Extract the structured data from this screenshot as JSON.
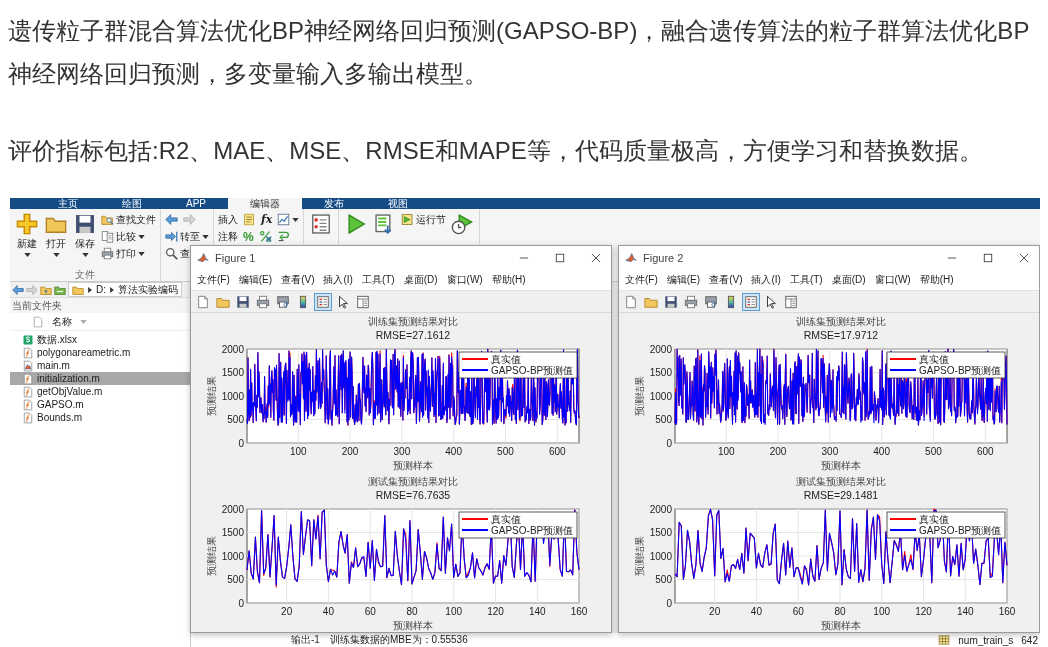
{
  "article": {
    "paragraphs": [
      "遗传粒子群混合算法优化BP神经网络回归预测(GAPSO-BP)，融合遗传算法的粒子群算法优化BP神经网络回归预测，多变量输入多输出模型。",
      "评价指标包括:R2、MAE、MSE、RMSE和MAPE等，代码质量极高，方便学习和替换数据。"
    ]
  },
  "matlab": {
    "tabs": [
      {
        "label": "主页",
        "selected": false
      },
      {
        "label": "绘图",
        "selected": false
      },
      {
        "label": "APP",
        "selected": false
      },
      {
        "label": "编辑器",
        "selected": true
      },
      {
        "label": "发布",
        "selected": false
      },
      {
        "label": "视图",
        "selected": false
      }
    ],
    "ribbon_groups": [
      {
        "label": "文件",
        "columns": [
          {
            "button": {
              "kind": "new",
              "label": "新建",
              "dropdown": true
            }
          },
          {
            "button": {
              "kind": "open",
              "label": "打开",
              "dropdown": true
            }
          },
          {
            "button": {
              "kind": "save",
              "label": "保存",
              "dropdown": true
            }
          },
          {
            "rows": [
              [
                {
                  "kind": "findfile",
                  "label": "查找文件",
                  "dropdown": false
                }
              ],
              [
                {
                  "kind": "compare",
                  "label": "比较",
                  "dropdown": true
                }
              ],
              [
                {
                  "kind": "print",
                  "label": "打印",
                  "dropdown": true
                }
              ]
            ]
          }
        ]
      },
      {
        "columns": [
          {
            "rows": [
              [
                {
                  "kind": "back",
                  "dropdown": false
                },
                {
                  "kind": "forward",
                  "dropdown": false
                }
              ],
              [
                {
                  "kind": "goto",
                  "label": "转至",
                  "dropdown": true
                }
              ],
              [
                {
                  "kind": "find",
                  "label": "查",
                  "dropdown": false
                }
              ]
            ]
          }
        ]
      },
      {
        "columns": [
          {
            "rows": [
              [
                {
                  "kind": "text",
                  "label": "插入",
                  "dropdown": false
                },
                {
                  "kind": "note",
                  "dropdown": false
                },
                {
                  "kind": "fx",
                  "label": "fx",
                  "dropdown": false
                },
                {
                  "kind": "figure",
                  "dropdown": true
                }
              ],
              [
                {
                  "kind": "text",
                  "label": "注释",
                  "dropdown": false
                },
                {
                  "kind": "glyph",
                  "label": "%",
                  "dropdown": false
                },
                {
                  "kind": "uncomment",
                  "dropdown": false
                },
                {
                  "kind": "wrap",
                  "dropdown": false
                }
              ]
            ]
          }
        ]
      },
      {
        "columns": [
          {
            "button": {
              "kind": "breakpoint",
              "dropdown": false
            }
          }
        ]
      },
      {
        "columns": [
          {
            "button": {
              "kind": "run",
              "dropdown": false
            }
          },
          {
            "button": {
              "kind": "runadvance",
              "dropdown": false
            }
          },
          {
            "rows": [
              [
                {
                  "kind": "runsection",
                  "label": "运行节",
                  "dropdown": false
                }
              ]
            ]
          },
          {
            "button": {
              "kind": "runtime",
              "dropdown": false
            }
          }
        ]
      }
    ],
    "path": [
      "D:",
      "算法实验编码"
    ],
    "panel_title": "当前文件夹",
    "column_header": "名称",
    "files": [
      {
        "name": "数据.xlsx",
        "kind": "excel",
        "selected": false
      },
      {
        "name": "polygonareametric.m",
        "kind": "function",
        "selected": false
      },
      {
        "name": "main.m",
        "kind": "script",
        "selected": false
      },
      {
        "name": "initialization.m",
        "kind": "function",
        "selected": true
      },
      {
        "name": "getObjValue.m",
        "kind": "function",
        "selected": false
      },
      {
        "name": "GAPSO.m",
        "kind": "function",
        "selected": false
      },
      {
        "name": "Bounds.m",
        "kind": "function",
        "selected": false
      }
    ],
    "command_output": {
      "prompt": "输出-1",
      "text": "训练集数据的MBE为：0.55536"
    },
    "workspace_row": {
      "name": "num_train_s",
      "value": "642"
    }
  },
  "figures": [
    {
      "title": "Figure 1",
      "menu": [
        "文件(F)",
        "编辑(E)",
        "查看(V)",
        "插入(I)",
        "工具(T)",
        "桌面(D)",
        "窗口(W)",
        "帮助(H)"
      ],
      "toolbar": [
        {
          "kind": "newfig",
          "pressed": false
        },
        {
          "kind": "open",
          "pressed": false
        },
        {
          "kind": "save",
          "pressed": false
        },
        {
          "kind": "print",
          "pressed": false
        },
        {
          "kind": "preview",
          "pressed": false
        },
        {
          "kind": "colorbar",
          "pressed": false
        },
        {
          "kind": "legend",
          "pressed": true
        },
        {
          "kind": "pointer",
          "pressed": false
        },
        {
          "kind": "inspector",
          "pressed": false
        }
      ],
      "plots": [
        {
          "title": "训练集预测结果对比",
          "subtitle": "RMSE=27.1612",
          "ylabel": "预测结果",
          "xlabel": "预测样本",
          "yticks": [
            "2000",
            "1500",
            "1000",
            "500",
            "0"
          ],
          "xticks": [
            "100",
            "200",
            "300",
            "400",
            "500",
            "600"
          ],
          "legend": [
            {
              "label": "真实值",
              "color": "#ff0000"
            },
            {
              "label": "GAPSO-BP预测值",
              "color": "#0000ff"
            }
          ]
        },
        {
          "title": "测试集预测结果对比",
          "subtitle": "RMSE=76.7635",
          "ylabel": "预测结果",
          "xlabel": "预测样本",
          "yticks": [
            "2000",
            "1500",
            "1000",
            "500",
            "0"
          ],
          "xticks": [
            "20",
            "40",
            "60",
            "80",
            "100",
            "120",
            "140",
            "160"
          ],
          "legend": [
            {
              "label": "真实值",
              "color": "#ff0000"
            },
            {
              "label": "GAPSO-BP预测值",
              "color": "#0000ff"
            }
          ]
        }
      ]
    },
    {
      "title": "Figure 2",
      "menu": [
        "文件(F)",
        "编辑(E)",
        "查看(V)",
        "插入(I)",
        "工具(T)",
        "桌面(D)",
        "窗口(W)",
        "帮助(H)"
      ],
      "toolbar": [
        {
          "kind": "newfig",
          "pressed": false
        },
        {
          "kind": "open",
          "pressed": false
        },
        {
          "kind": "save",
          "pressed": false
        },
        {
          "kind": "print",
          "pressed": false
        },
        {
          "kind": "preview",
          "pressed": false
        },
        {
          "kind": "colorbar",
          "pressed": false
        },
        {
          "kind": "legend",
          "pressed": true
        },
        {
          "kind": "pointer",
          "pressed": false
        },
        {
          "kind": "inspector",
          "pressed": false
        }
      ],
      "plots": [
        {
          "title": "训练集预测结果对比",
          "subtitle": "RMSE=17.9712",
          "ylabel": "预测结果",
          "xlabel": "预测样本",
          "yticks": [
            "2000",
            "1500",
            "1000",
            "500",
            "0"
          ],
          "xticks": [
            "100",
            "200",
            "300",
            "400",
            "500",
            "600"
          ],
          "legend": [
            {
              "label": "真实值",
              "color": "#ff0000"
            },
            {
              "label": "GAPSO-BP预测值",
              "color": "#0000ff"
            }
          ]
        },
        {
          "title": "测试集预测结果对比",
          "subtitle": "RMSE=29.1481",
          "ylabel": "预测结果",
          "xlabel": "预测样本",
          "yticks": [
            "2000",
            "1500",
            "1000",
            "500",
            "0"
          ],
          "xticks": [
            "20",
            "40",
            "60",
            "80",
            "100",
            "120",
            "140",
            "160"
          ],
          "legend": [
            {
              "label": "真实值",
              "color": "#ff0000"
            },
            {
              "label": "GAPSO-BP预测值",
              "color": "#0000ff"
            }
          ]
        }
      ]
    }
  ]
}
